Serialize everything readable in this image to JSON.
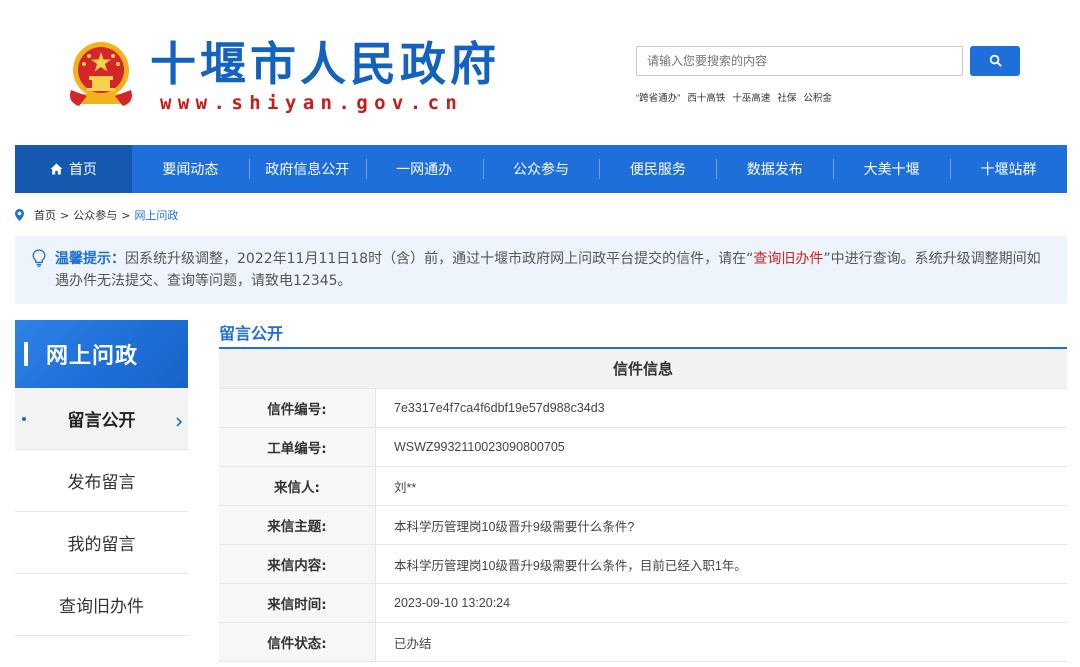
{
  "header": {
    "site_title": "十堰市人民政府",
    "site_url": "www.shiyan.gov.cn",
    "emblem_icon": "national-emblem-icon",
    "search": {
      "placeholder": "请输入您要搜索的内容",
      "button_icon": "search-icon"
    },
    "hotwords": [
      "“跨省通办”",
      "西十高铁",
      "十巫高速",
      "社保",
      "公积金"
    ]
  },
  "nav": {
    "items": [
      {
        "label": "首页",
        "icon": "home-icon",
        "active": true
      },
      {
        "label": "要闻动态"
      },
      {
        "label": "政府信息公开"
      },
      {
        "label": "一网通办"
      },
      {
        "label": "公众参与"
      },
      {
        "label": "便民服务"
      },
      {
        "label": "数据发布"
      },
      {
        "label": "大美十堰"
      },
      {
        "label": "十堰站群"
      }
    ]
  },
  "breadcrumb": {
    "icon": "location-pin-icon",
    "items": [
      "首页",
      "公众参与",
      "网上问政"
    ],
    "separator": ">"
  },
  "notice": {
    "icon": "lightbulb-icon",
    "label": "温馨提示：",
    "text_before": "因系统升级调整，2022年11月11日18时（含）前，通过十堰市政府网上问政平台提交的信件，请在“",
    "link_text": "查询旧办件",
    "text_after": "”中进行查询。系统升级调整期间如遇办件无法提交、查询等问题，请致电12345。"
  },
  "sidebar": {
    "title": "网上问政",
    "items": [
      {
        "label": "留言公开",
        "active": true
      },
      {
        "label": "发布留言"
      },
      {
        "label": "我的留言"
      },
      {
        "label": "查询旧办件"
      }
    ]
  },
  "main": {
    "section_title": "留言公开",
    "table_title": "信件信息",
    "rows": [
      {
        "label": "信件编号:",
        "value": "7e3317e4f7ca4f6dbf19e57d988c34d3"
      },
      {
        "label": "工单编号:",
        "value": "WSWZ9932110023090800705"
      },
      {
        "label": "来信人:",
        "value": "刘**"
      },
      {
        "label": "来信主题:",
        "value": "本科学历管理岗10级晋升9级需要什么条件?"
      },
      {
        "label": "来信内容:",
        "value": "本科学历管理岗10级晋升9级需要什么条件，目前已经入职1年。"
      },
      {
        "label": "来信时间:",
        "value": "2023-09-10 13:20:24"
      },
      {
        "label": "信件状态:",
        "value": "已办结"
      }
    ]
  },
  "colors": {
    "primary": "#1e6fd9",
    "nav_active": "#1558b0",
    "title_blue": "#1462c0",
    "url_red": "#c51c1c",
    "notice_bg": "#eef4fb",
    "link_red": "#d92121"
  }
}
